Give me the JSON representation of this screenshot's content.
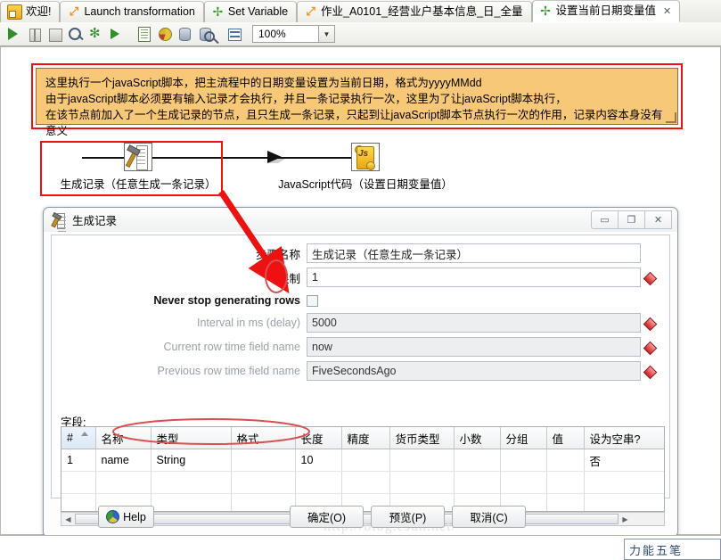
{
  "tabs": [
    {
      "label": "欢迎!",
      "icon": "welcome-card-icon",
      "active": false,
      "closable": false
    },
    {
      "label": "Launch transformation",
      "icon": "transformation-arrows-icon",
      "active": false,
      "closable": false
    },
    {
      "label": "Set Variable",
      "icon": "kettle-green-x-icon",
      "active": false,
      "closable": false
    },
    {
      "label": "作业_A0101_经营业户基本信息_日_全量",
      "icon": "transformation-arrows-icon",
      "active": false,
      "closable": false
    },
    {
      "label": "设置当前日期变量值",
      "icon": "kettle-green-x-icon",
      "active": true,
      "closable": true,
      "close_glyph": "✕"
    }
  ],
  "toolbar": {
    "buttons": [
      {
        "name": "run-button",
        "icon": "play-icon"
      },
      {
        "name": "pause-button",
        "icon": "pause-icon"
      },
      {
        "name": "stop-button",
        "icon": "stop-icon"
      },
      {
        "name": "preview-button",
        "icon": "magnifier-icon"
      },
      {
        "name": "debug-button",
        "icon": "bug-icon"
      },
      {
        "name": "replay-button",
        "icon": "play-clock-icon"
      },
      {
        "name": "verify-button",
        "icon": "checked-sheet-icon"
      },
      {
        "name": "impact-analysis-button",
        "icon": "pie-chart-icon"
      },
      {
        "name": "sql-button",
        "icon": "database-run-icon"
      },
      {
        "name": "database-explorer-button",
        "icon": "database-search-icon"
      },
      {
        "name": "show-grid-button",
        "icon": "grid-icon"
      }
    ],
    "zoom_value": "100%",
    "zoom_arrow": "▼"
  },
  "note": {
    "lines": [
      "这里执行一个javaScript脚本，把主流程中的日期变量设置为当前日期，格式为yyyyMMdd",
      "由于javaScript脚本必须要有输入记录才会执行，并且一条记录执行一次，这里为了让javaScript脚本执行，",
      "在该节点前加入了一个生成记录的节点，且只生成一条记录，只起到让javaScript脚本节点执行一次的作用，记录内容本身没有意义"
    ],
    "bg_color": "#f8c879",
    "selection_color": "#ee1111"
  },
  "canvas": {
    "nodes": [
      {
        "name": "generate-rows-node",
        "label": "生成记录（任意生成一条记录）",
        "icon": "hammer-ladder-icon",
        "selected": true
      },
      {
        "name": "javascript-node",
        "label": "JavaScript代码（设置日期变量值）",
        "icon": "js-scroll-icon",
        "selected": false
      }
    ]
  },
  "dialog": {
    "title": "生成记录",
    "title_icon": "hammer-ladder-icon",
    "window_buttons": [
      {
        "name": "minimize-button",
        "glyph": "▭"
      },
      {
        "name": "maximize-button",
        "glyph": "❐"
      },
      {
        "name": "close-button",
        "glyph": "✕"
      }
    ],
    "fields": [
      {
        "label": "步骤名称",
        "value": "生成记录（任意生成一条记录）",
        "disabled": false,
        "has_variable_icon": false
      },
      {
        "label": "限制",
        "value": "1",
        "disabled": false,
        "has_variable_icon": true
      },
      {
        "label": "Never stop generating rows",
        "value": "",
        "disabled": false,
        "has_variable_icon": false,
        "type": "checkbox",
        "checked": false
      },
      {
        "label": "Interval in ms (delay)",
        "value": "5000",
        "disabled": true,
        "has_variable_icon": true
      },
      {
        "label": "Current row time field name",
        "value": "now",
        "disabled": true,
        "has_variable_icon": true
      },
      {
        "label": "Previous row time field name",
        "value": "FiveSecondsAgo",
        "disabled": true,
        "has_variable_icon": true
      }
    ],
    "watermark": "http://blog.csdn.net/",
    "fields_label": "字段:",
    "grid": {
      "columns": [
        "#",
        "名称",
        "类型",
        "格式",
        "长度",
        "精度",
        "货币类型",
        "小数",
        "分组",
        "值",
        "设为空串?"
      ],
      "rows": [
        [
          "1",
          "name",
          "String",
          "",
          "10",
          "",
          "",
          "",
          "",
          "",
          "否"
        ],
        [
          "",
          "",
          "",
          "",
          "",
          "",
          "",
          "",
          "",
          "",
          ""
        ],
        [
          "",
          "",
          "",
          "",
          "",
          "",
          "",
          "",
          "",
          "",
          ""
        ]
      ],
      "scroll_left_glyph": "◀",
      "scroll_right_glyph": "▶",
      "thumb_grip": "|||"
    },
    "buttons": [
      {
        "name": "help-button",
        "label": "Help",
        "icon": "help-globe-icon"
      },
      {
        "name": "ok-button",
        "label": "确定(O)"
      },
      {
        "name": "preview-button",
        "label": "预览(P)"
      },
      {
        "name": "cancel-button",
        "label": "取消(C)"
      }
    ]
  },
  "ime_bar": {
    "text": "力能五笔"
  },
  "annotation": {
    "arrow_color": "#ee1111",
    "ellipse_color": "#d95050"
  }
}
